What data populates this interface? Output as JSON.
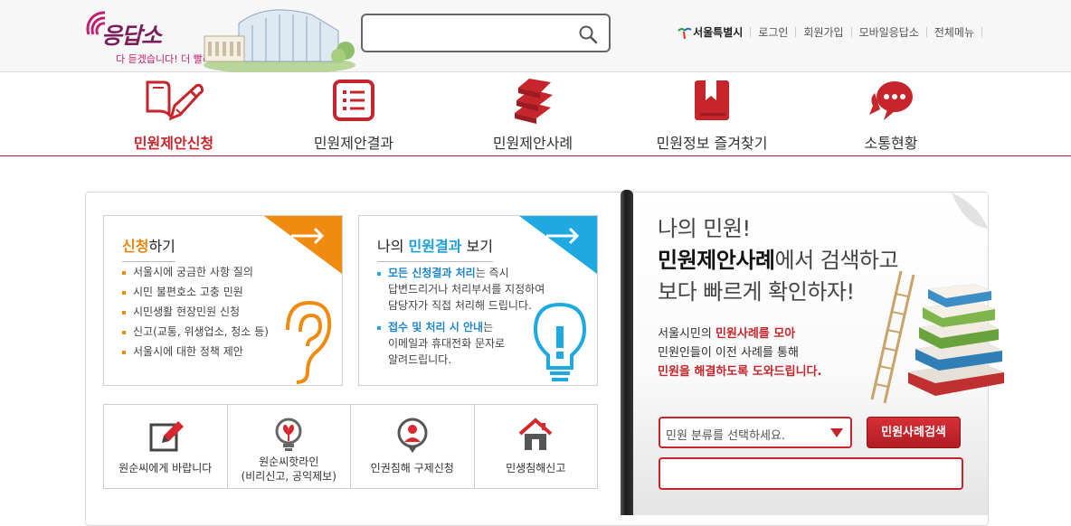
{
  "header": {
    "logo_text": "응답소",
    "logo_tagline": "다 듣겠습니다! 더 빨라집니다",
    "search": {
      "value": "",
      "placeholder": ""
    },
    "util_nav": [
      "서울특별시",
      "로그인",
      "회원가입",
      "모바일응답소",
      "전체메뉴"
    ]
  },
  "main_nav": [
    {
      "label": "민원제안신청",
      "icon": "pencil-book-icon",
      "active": true
    },
    {
      "label": "민원제안결과",
      "icon": "list-document-icon",
      "active": false
    },
    {
      "label": "민원제안사례",
      "icon": "stacked-books-icon",
      "active": false
    },
    {
      "label": "민원정보 즐겨찾기",
      "icon": "bookmark-icon",
      "active": false
    },
    {
      "label": "소통현황",
      "icon": "speech-bubble-icon",
      "active": false
    }
  ],
  "apply_card": {
    "title_hl": "신청",
    "title_rest": "하기",
    "items": [
      "서울시에 궁금한 사항 질의",
      "시민 불편호소 고충 민원",
      "시민생활 현장민원 신청",
      "신고(교통, 위생업소, 청소 등)",
      "서울시에 대한 정책 제안"
    ]
  },
  "result_card": {
    "title_pre": "나의 ",
    "title_hl": "민원결과",
    "title_post": " 보기",
    "p1_hl": "모든 신청결과 처리",
    "p1_rest": "는 즉시",
    "p1_line2": "답변드리거나 처리부서를 지정하여",
    "p1_line3": "담당자가 직접 처리해 드립니다.",
    "p2_hl": "접수 및 처리 시 안내",
    "p2_rest": "는",
    "p2_line2": "이메일과 휴대전화 문자로",
    "p2_line3": "알려드립니다."
  },
  "quick_links": [
    {
      "label": "원순씨에게 바랍니다",
      "label2": "",
      "icon": "edit-note-icon"
    },
    {
      "label": "원순씨핫라인",
      "label2": "(비리신고, 공익제보)",
      "icon": "hotline-bulb-icon"
    },
    {
      "label": "인권침해 구제신청",
      "label2": "",
      "icon": "human-rights-icon"
    },
    {
      "label": "민생침해신고",
      "label2": "",
      "icon": "house-icon"
    }
  ],
  "promo": {
    "line1": "나의 민원!",
    "line2_bold": "민원제안사례",
    "line2_rest": "에서 검색하고",
    "line3": "보다 빠르게 확인하자!",
    "body1_pre": "서울시민의 ",
    "body1_red": "민원사례를 모아",
    "body2": "민원인들이 이전 사례를 통해",
    "body3_red": "민원을 해결하도록 도와드립니다."
  },
  "case_search": {
    "select_label": "민원 분류를 선택하세요.",
    "button_label": "민원사례검색",
    "input_value": "",
    "input_placeholder": ""
  },
  "colors": {
    "accent_red": "#c6252c",
    "orange": "#f08b12",
    "blue": "#1ea9e1"
  }
}
